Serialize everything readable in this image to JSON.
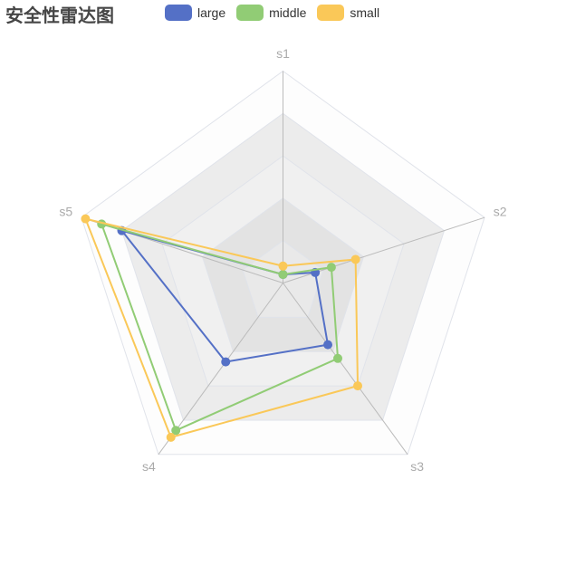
{
  "chart_data": {
    "type": "radar",
    "title": "安全性雷达图",
    "indicators": [
      "s1",
      "s2",
      "s3",
      "s4",
      "s5"
    ],
    "max": 5,
    "split_number": 5,
    "series": [
      {
        "name": "large",
        "color": "#5470c6",
        "values": [
          0.2,
          0.8,
          1.8,
          2.3,
          4.0
        ]
      },
      {
        "name": "middle",
        "color": "#91cc75",
        "values": [
          0.2,
          1.2,
          2.2,
          4.3,
          4.5
        ]
      },
      {
        "name": "small",
        "color": "#fac858",
        "values": [
          0.4,
          1.8,
          3.0,
          4.5,
          4.9
        ]
      }
    ]
  }
}
